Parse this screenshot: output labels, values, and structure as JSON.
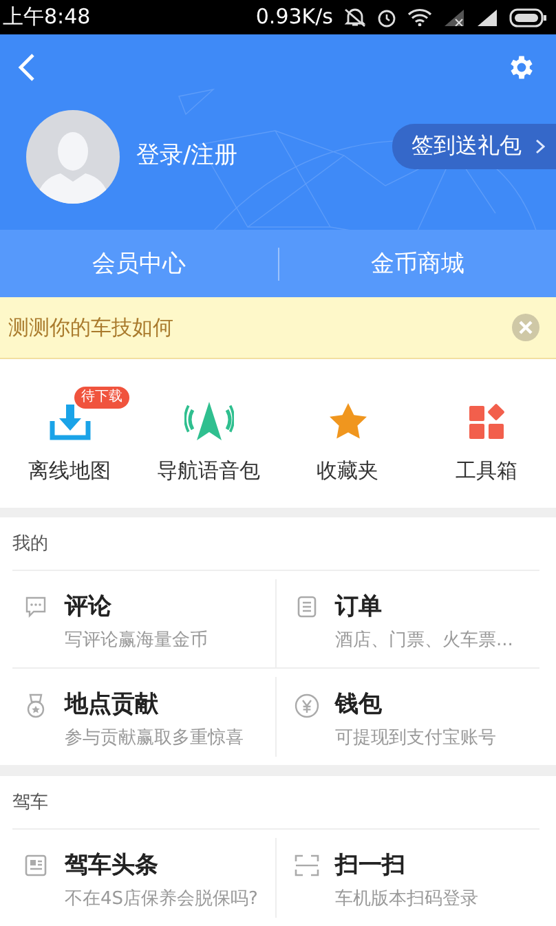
{
  "status_bar": {
    "time": "上午8:48",
    "speed": "0.93K/s"
  },
  "header": {
    "login": "登录/注册",
    "signin": "签到送礼包"
  },
  "tabs": [
    {
      "label": "会员中心"
    },
    {
      "label": "金币商城"
    }
  ],
  "banner": {
    "text": "测测你的车技如何"
  },
  "shortcuts": [
    {
      "label": "离线地图",
      "badge": "待下载"
    },
    {
      "label": "导航语音包"
    },
    {
      "label": "收藏夹"
    },
    {
      "label": "工具箱"
    }
  ],
  "sections": [
    {
      "title": "我的",
      "items": [
        {
          "title": "评论",
          "subtitle": "写评论赢海量金币"
        },
        {
          "title": "订单",
          "subtitle": "酒店、门票、火车票..."
        },
        {
          "title": "地点贡献",
          "subtitle": "参与贡献赢取多重惊喜"
        },
        {
          "title": "钱包",
          "subtitle": "可提现到支付宝账号"
        }
      ]
    },
    {
      "title": "驾车",
      "items": [
        {
          "title": "驾车头条",
          "subtitle": "不在4S店保养会脱保吗?"
        },
        {
          "title": "扫一扫",
          "subtitle": "车机版本扫码登录"
        }
      ]
    }
  ]
}
